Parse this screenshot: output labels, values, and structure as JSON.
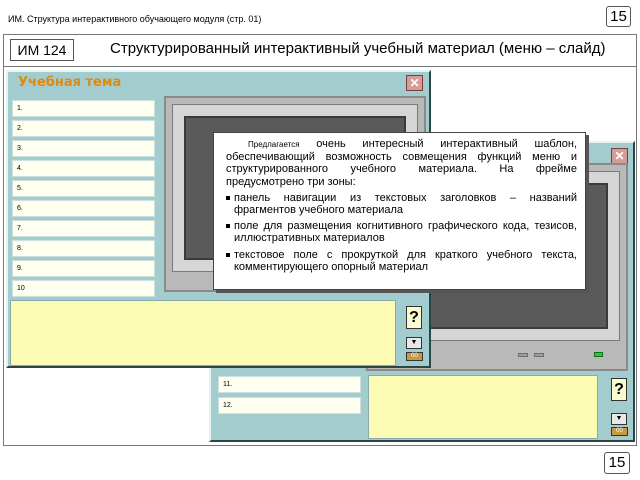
{
  "header": {
    "caption": "ИМ. Структура интерактивного обучающего модуля  (стр. 01)",
    "page_number_top": "15",
    "im_code": "ИМ 124",
    "title": "Структурированный интерактивный учебный материал (меню – слайд)",
    "page_number_bottom": "15"
  },
  "front_window": {
    "title": "Учебная тема",
    "close_glyph": "✕",
    "nav_items": [
      "1.",
      "2.",
      "3.",
      "4.",
      "5.",
      "6.",
      "7.",
      "8.",
      "9.",
      "10"
    ],
    "help_glyph": "?",
    "scroll_glyph": "▼",
    "extra_button": "00"
  },
  "back_window": {
    "close_glyph": "✕",
    "nav_items": [
      "11.",
      "12."
    ],
    "help_glyph": "?",
    "scroll_glyph": "▼",
    "extra_button": "00"
  },
  "callout": {
    "intro_lead": "Предлагается",
    "intro_rest": " очень интересный интерактивный шаблон, обеспечивающий возможность совмещения функций меню и структурированного учебного материала. На фрейме предусмотрено три зоны:",
    "bullets": [
      "панель навигации из текстовых заголовков – названий фрагментов учебного материала",
      "поле для размещения когнитивного графического кода, тезисов, иллюстративных материалов",
      "текстовое поле с прокруткой для краткого учебного текста, комментирующего опорный материал"
    ]
  },
  "colors": {
    "window_bg": "#a3ccce",
    "title_color": "#d98b14",
    "text_zone": "#fbfbb4",
    "screen": "#5a5a5a",
    "led": "#28c83a"
  }
}
